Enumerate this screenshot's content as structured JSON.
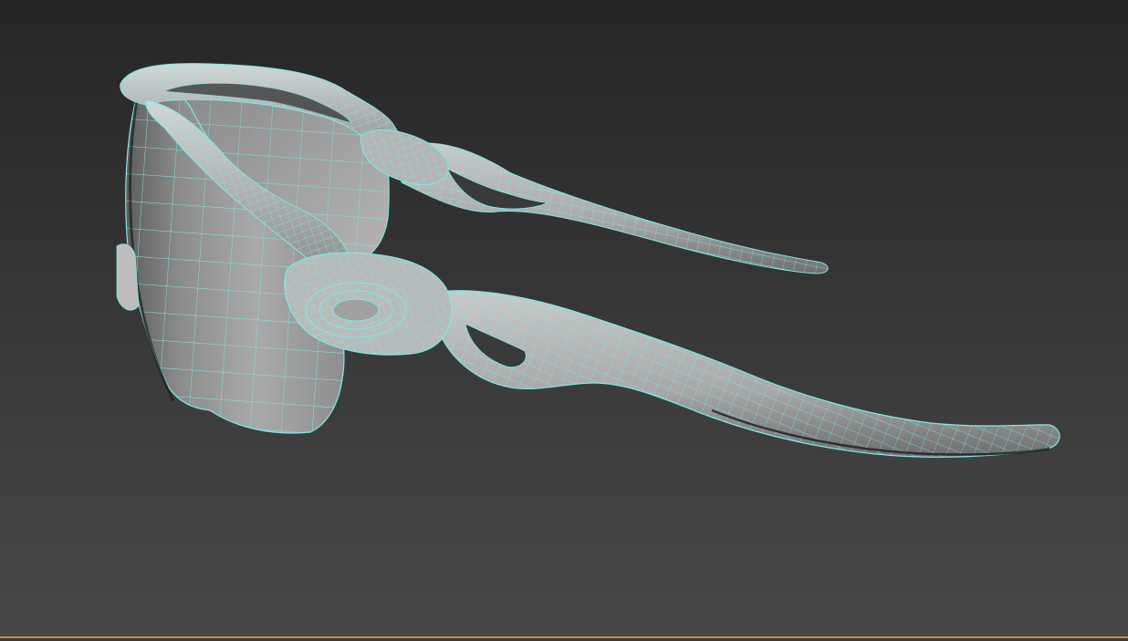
{
  "viewport": {
    "display_mode": "shaded-with-wireframe",
    "object": "sunglasses-model",
    "colors": {
      "background_top": "#262626",
      "background_bottom": "#474747",
      "surface": "#a8a8a8",
      "wireframe": "#7fe8e6",
      "active_border": "#d98a3a"
    }
  }
}
